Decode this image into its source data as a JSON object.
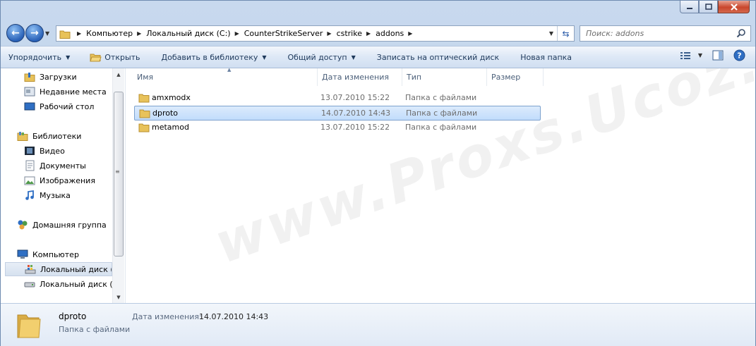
{
  "window": {
    "minimize_icon": "minimize-icon",
    "maximize_icon": "maximize-icon",
    "close_icon": "close-icon"
  },
  "address": {
    "crumbs": [
      "Компьютер",
      "Локальный диск (C:)",
      "CounterStrikeServer",
      "cstrike",
      "addons"
    ],
    "search_placeholder": "Поиск: addons"
  },
  "commands": {
    "organize": "Упорядочить",
    "open": "Открыть",
    "add_to_library": "Добавить в библиотеку",
    "share": "Общий доступ",
    "burn": "Записать на оптический диск",
    "new_folder": "Новая папка"
  },
  "nav": {
    "downloads": "Загрузки",
    "recent": "Недавние места",
    "desktop": "Рабочий стол",
    "libraries": "Библиотеки",
    "video": "Видео",
    "documents": "Документы",
    "images": "Изображения",
    "music": "Музыка",
    "homegroup": "Домашняя группа",
    "computer": "Компьютер",
    "disk_c": "Локальный диск (C",
    "disk_d": "Локальный диск (D"
  },
  "columns": {
    "name": "Имя",
    "date": "Дата изменения",
    "type": "Тип",
    "size": "Размер"
  },
  "files": [
    {
      "name": "amxmodx",
      "date": "13.07.2010 15:22",
      "type": "Папка с файлами"
    },
    {
      "name": "dproto",
      "date": "14.07.2010 14:43",
      "type": "Папка с файлами"
    },
    {
      "name": "metamod",
      "date": "13.07.2010 15:22",
      "type": "Папка с файлами"
    }
  ],
  "watermark": "www.Proxs.Ucoz.Ru",
  "details": {
    "name": "dproto",
    "type": "Папка с файлами",
    "date_label": "Дата изменения:",
    "date_value": "14.07.2010 14:43"
  },
  "colors": {
    "selection": "#c1dcfc",
    "accent": "#1e395b",
    "folder": "#e8c25a"
  }
}
